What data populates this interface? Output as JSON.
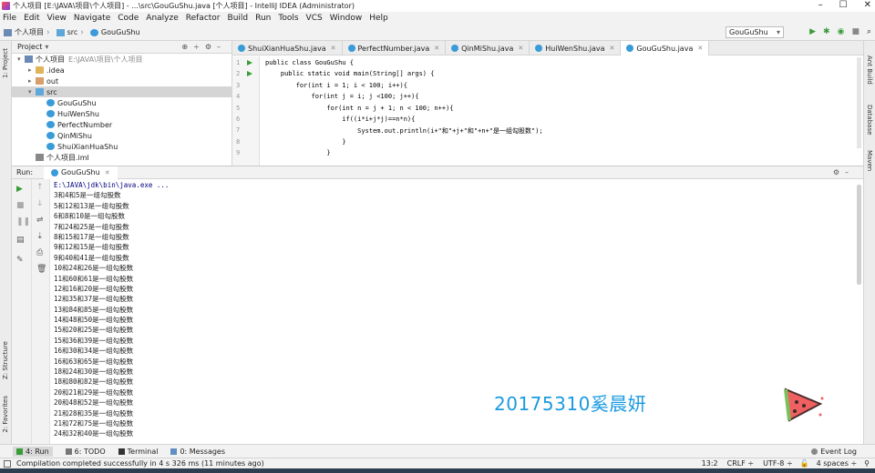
{
  "window": {
    "title": "个人项目 [E:\\JAVA\\项目\\个人项目] - ...\\src\\GouGuShu.java [个人项目] - IntelliJ IDEA (Administrator)"
  },
  "menu": [
    "File",
    "Edit",
    "View",
    "Navigate",
    "Code",
    "Analyze",
    "Refactor",
    "Build",
    "Run",
    "Tools",
    "VCS",
    "Window",
    "Help"
  ],
  "breadcrumb": [
    "个人项目",
    "src",
    "GouGuShu"
  ],
  "run_config": "GouGuShu",
  "project": {
    "header": "Project",
    "tree": [
      {
        "label": "个人项目",
        "extra": "E:\\JAVA\\项目\\个人项目",
        "indent": 0,
        "icon": "module-icon",
        "arrow": "▾"
      },
      {
        "label": ".idea",
        "extra": "",
        "indent": 1,
        "icon": "folder-icon",
        "arrow": "▸"
      },
      {
        "label": "out",
        "extra": "",
        "indent": 1,
        "icon": "excluded-folder-icon",
        "arrow": "▸"
      },
      {
        "label": "src",
        "extra": "",
        "indent": 1,
        "icon": "source-folder-icon",
        "arrow": "▾",
        "selected": true
      },
      {
        "label": "GouGuShu",
        "extra": "",
        "indent": 2,
        "icon": "class-icon",
        "arrow": ""
      },
      {
        "label": "HuiWenShu",
        "extra": "",
        "indent": 2,
        "icon": "class-icon",
        "arrow": ""
      },
      {
        "label": "PerfectNumber",
        "extra": "",
        "indent": 2,
        "icon": "class-icon",
        "arrow": ""
      },
      {
        "label": "QinMiShu",
        "extra": "",
        "indent": 2,
        "icon": "class-icon",
        "arrow": ""
      },
      {
        "label": "ShuiXianHuaShu",
        "extra": "",
        "indent": 2,
        "icon": "class-icon",
        "arrow": ""
      },
      {
        "label": "个人项目.iml",
        "extra": "",
        "indent": 1,
        "icon": "iml-file-icon",
        "arrow": ""
      }
    ]
  },
  "editor": {
    "tabs": [
      {
        "label": "ShuiXianHuaShu.java",
        "active": false
      },
      {
        "label": "PerfectNumber.java",
        "active": false
      },
      {
        "label": "QinMiShu.java",
        "active": false
      },
      {
        "label": "HuiWenShu.java",
        "active": false
      },
      {
        "label": "GouGuShu.java",
        "active": true
      }
    ],
    "line_numbers": [
      "1",
      "2",
      "3",
      "4",
      "5",
      "6",
      "7",
      "8",
      "9"
    ],
    "code": [
      "public class GouGuShu {",
      "    public static void main(String[] args) {",
      "        for(int i = 1; i < 100; i++){",
      "            for(int j = i; j <100; j++){",
      "                for(int n = j + 1; n < 100; n++){",
      "                    if((i*i+j*j)==n*n){",
      "                        System.out.println(i+\"和\"+j+\"和\"+n+\"是一组勾股数\");",
      "                    }",
      "                }"
    ]
  },
  "run": {
    "label": "Run:",
    "tab": "GouGuShu",
    "command": "E:\\JAVA\\jdk\\bin\\java.exe ...",
    "output": [
      "3和4和5是一组勾股数",
      "5和12和13是一组勾股数",
      "6和8和10是一组勾股数",
      "7和24和25是一组勾股数",
      "8和15和17是一组勾股数",
      "9和12和15是一组勾股数",
      "9和40和41是一组勾股数",
      "10和24和26是一组勾股数",
      "11和60和61是一组勾股数",
      "12和16和20是一组勾股数",
      "12和35和37是一组勾股数",
      "13和84和85是一组勾股数",
      "14和48和50是一组勾股数",
      "15和20和25是一组勾股数",
      "15和36和39是一组勾股数",
      "16和30和34是一组勾股数",
      "16和63和65是一组勾股数",
      "18和24和30是一组勾股数",
      "18和80和82是一组勾股数",
      "20和21和29是一组勾股数",
      "20和48和52是一组勾股数",
      "21和28和35是一组勾股数",
      "21和72和75是一组勾股数",
      "24和32和40是一组勾股数"
    ]
  },
  "watermark": "20175310奚晨妍",
  "bottom_tabs": [
    "4: Run",
    "6: TODO",
    "Terminal",
    "0: Messages"
  ],
  "event_log": "Event Log",
  "status": {
    "message": "Compilation completed successfully in 4 s 326 ms (11 minutes ago)",
    "position": "13:2",
    "line_sep": "CRLF ÷",
    "encoding": "UTF-8 ÷",
    "indent": "4 spaces ÷"
  },
  "side_labels": {
    "project": "1: Project",
    "structure": "Z: Structure",
    "favorites": "2: Favorites",
    "ant": "Ant Build",
    "database": "Database",
    "maven": "Maven"
  },
  "colors": {
    "accent": "#1a9ae0",
    "run_green": "#3a9b3a"
  }
}
